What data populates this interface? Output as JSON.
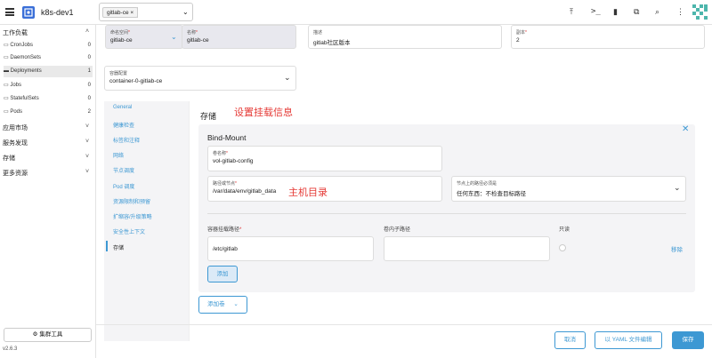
{
  "header": {
    "cluster_name": "k8s-dev1",
    "namespace_tag": "gitlab-ce",
    "namespace_tag_close": "×",
    "icons": [
      "upload-icon",
      "shell-icon",
      "file-icon",
      "copy-icon",
      "search-icon",
      "more-vertical-icon"
    ]
  },
  "sidebar": {
    "groups": {
      "workload": "工作负载",
      "app_market": "应用市场",
      "service_discovery": "服务发现",
      "storage": "存储",
      "more_resources": "更多资源"
    },
    "items": [
      {
        "label": "CronJobs",
        "count": "0"
      },
      {
        "label": "DaemonSets",
        "count": "0"
      },
      {
        "label": "Deployments",
        "count": "1"
      },
      {
        "label": "Jobs",
        "count": "0"
      },
      {
        "label": "StatefulSets",
        "count": "0"
      },
      {
        "label": "Pods",
        "count": "2"
      }
    ],
    "cluster_tools": "集群工具",
    "version": "v2.6.3"
  },
  "form": {
    "namespace": {
      "label": "命名空间",
      "value": "gitlab-ce"
    },
    "name": {
      "label": "名称",
      "value": "gitlab-ce"
    },
    "description": {
      "label": "描述",
      "value": "gitlab社区版本"
    },
    "replicas": {
      "label": "副本",
      "value": "2"
    },
    "container_config": {
      "label": "容器配置",
      "value": "container-0-gitlab-ce"
    }
  },
  "tabs": [
    "General",
    "健康检查",
    "标签和注释",
    "网络",
    "节点调度",
    "Pod 调度",
    "资源限制和预留",
    "扩缩容/升级策略",
    "安全性上下文",
    "存储"
  ],
  "storage": {
    "section_title": "存储",
    "annotation_title": "设置挂载信息",
    "card_title": "Bind-Mount",
    "volume_name": {
      "label": "卷名称",
      "value": "vol-gitlab-config"
    },
    "host_path": {
      "label": "路径或节点",
      "value": "/var/data/env/gitlab_data"
    },
    "annotation_host": "主机目录",
    "path_check": {
      "label": "节点上的路径必须是",
      "value": "任何东西：不检查目标路径"
    },
    "columns": {
      "mount_path": "容器挂载路径",
      "sub_path": "卷内子路径",
      "read_only": "只读"
    },
    "row": {
      "mount_path": "/etc/gitlab",
      "sub_path": "",
      "remove": "移除"
    },
    "add_button": "添加",
    "add_volume": "添加卷"
  },
  "footer": {
    "cancel": "取消",
    "edit_yaml": "以 YAML 文件编辑",
    "save": "保存"
  },
  "colors": {
    "accent": "#3d98d3",
    "annotation": "#e53935",
    "logo": "#3a6fd8"
  }
}
